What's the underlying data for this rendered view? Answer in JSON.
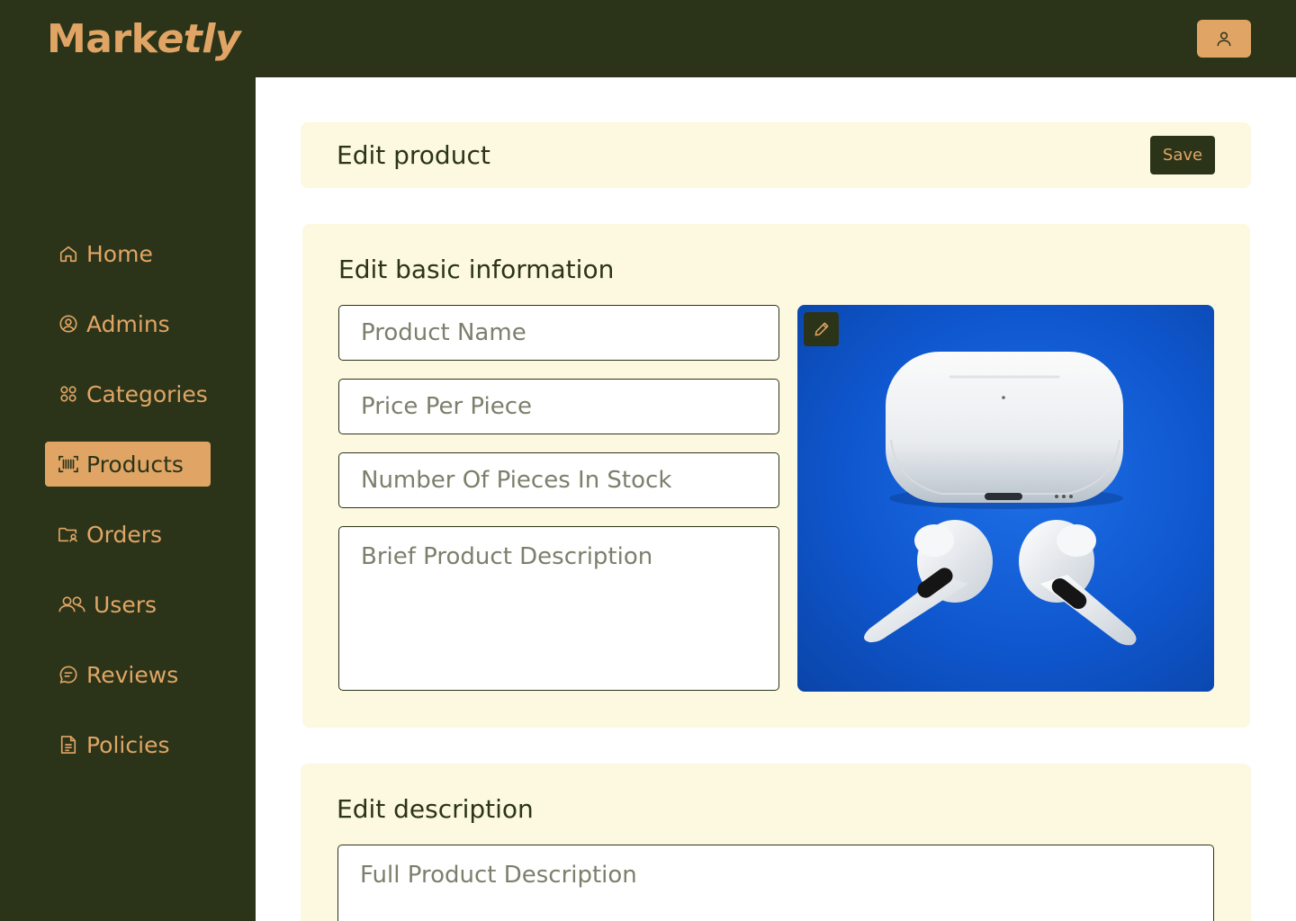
{
  "app": {
    "logo_main": "Mark",
    "logo_italic": "etly"
  },
  "header": {
    "profile_icon": "user-icon"
  },
  "sidebar": {
    "items": [
      {
        "label": "Home",
        "icon": "home-icon",
        "active": false
      },
      {
        "label": "Admins",
        "icon": "user-circle-icon",
        "active": false
      },
      {
        "label": "Categories",
        "icon": "grid-icon",
        "active": false
      },
      {
        "label": "Products",
        "icon": "barcode-icon",
        "active": true
      },
      {
        "label": "Orders",
        "icon": "folder-user-icon",
        "active": false
      },
      {
        "label": "Users",
        "icon": "users-icon",
        "active": false
      },
      {
        "label": "Reviews",
        "icon": "chat-icon",
        "active": false
      },
      {
        "label": "Policies",
        "icon": "document-icon",
        "active": false
      }
    ]
  },
  "page": {
    "title": "Edit product",
    "save_label": "Save"
  },
  "basic": {
    "title": "Edit basic information",
    "product_name_placeholder": "Product Name",
    "price_placeholder": "Price Per Piece",
    "stock_placeholder": "Number Of Pieces In Stock",
    "brief_placeholder": "Brief Product Description",
    "image_edit_icon": "pencil-icon"
  },
  "description": {
    "title": "Edit description",
    "full_placeholder": "Full Product Description"
  },
  "colors": {
    "dark_green": "#2b3419",
    "accent": "#e0a565",
    "card_bg": "#fdf8e0"
  }
}
